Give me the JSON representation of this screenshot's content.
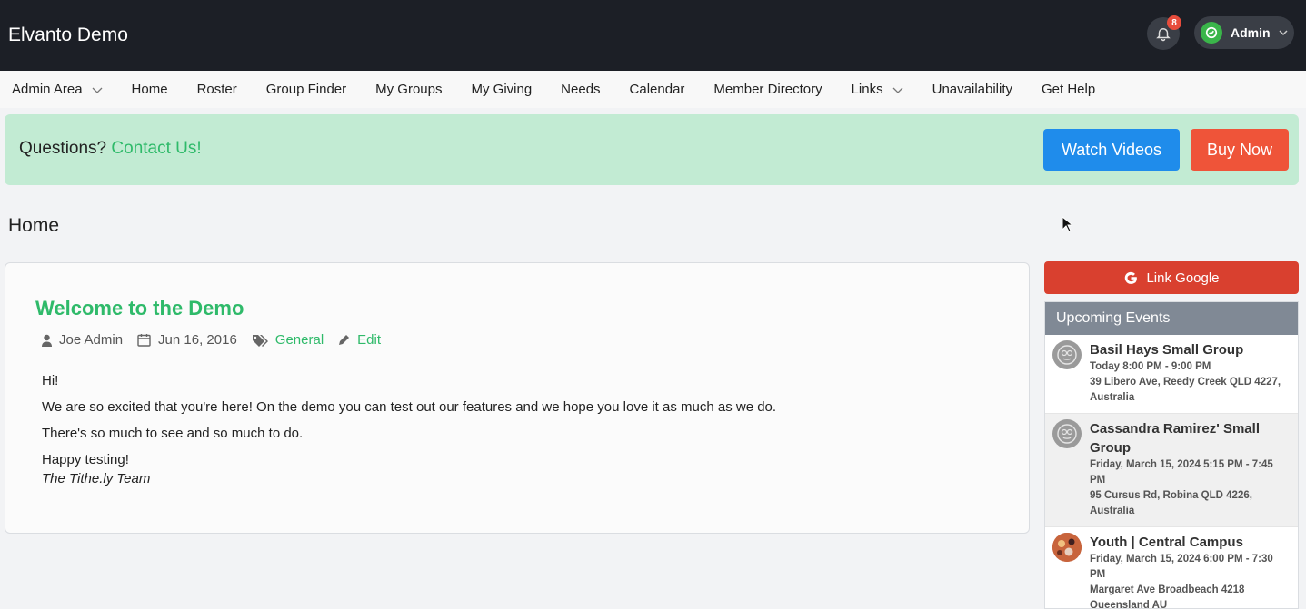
{
  "header": {
    "brand": "Elvanto Demo",
    "notification_count": "8",
    "user_label": "Admin"
  },
  "nav": {
    "items": [
      {
        "label": "Admin Area",
        "has_dropdown": true
      },
      {
        "label": "Home"
      },
      {
        "label": "Roster"
      },
      {
        "label": "Group Finder"
      },
      {
        "label": "My Groups"
      },
      {
        "label": "My Giving"
      },
      {
        "label": "Needs"
      },
      {
        "label": "Calendar"
      },
      {
        "label": "Member Directory"
      },
      {
        "label": "Links",
        "has_dropdown": true
      },
      {
        "label": "Unavailability"
      },
      {
        "label": "Get Help"
      }
    ]
  },
  "alert": {
    "text": "Questions?",
    "link": "Contact Us!",
    "watch_button": "Watch Videos",
    "buy_button": "Buy Now"
  },
  "page": {
    "title": "Home"
  },
  "post": {
    "title": "Welcome to the Demo",
    "author": "Joe Admin",
    "date": "Jun 16, 2016",
    "category": "General",
    "edit_label": "Edit",
    "body": [
      "Hi!",
      "We are so excited that you're here! On the demo you can test out our features and we hope you love it as much as we do.",
      "There's so much to see and so much to do.",
      "Happy testing!"
    ],
    "signature": "The Tithe.ly Team"
  },
  "sidebar": {
    "google_button": "Link Google",
    "events_heading": "Upcoming Events",
    "events": [
      {
        "name": "Basil Hays Small Group",
        "time": "Today 8:00 PM - 9:00 PM",
        "location": "39 Libero Ave, Reedy Creek QLD 4227, Australia"
      },
      {
        "name": "Cassandra Ramirez' Small Group",
        "time": "Friday, March 15, 2024 5:15 PM - 7:45 PM",
        "location": "95 Cursus Rd, Robina QLD 4226, Australia"
      },
      {
        "name": "Youth | Central Campus",
        "time": "Friday, March 15, 2024 6:00 PM - 7:30 PM",
        "location": "Margaret Ave Broadbeach 4218 Queensland AU"
      }
    ]
  },
  "colors": {
    "accent_green": "#2fba6a",
    "watch_blue": "#1f8ceb",
    "buy_red": "#ef5439",
    "google_red": "#d9402f"
  }
}
